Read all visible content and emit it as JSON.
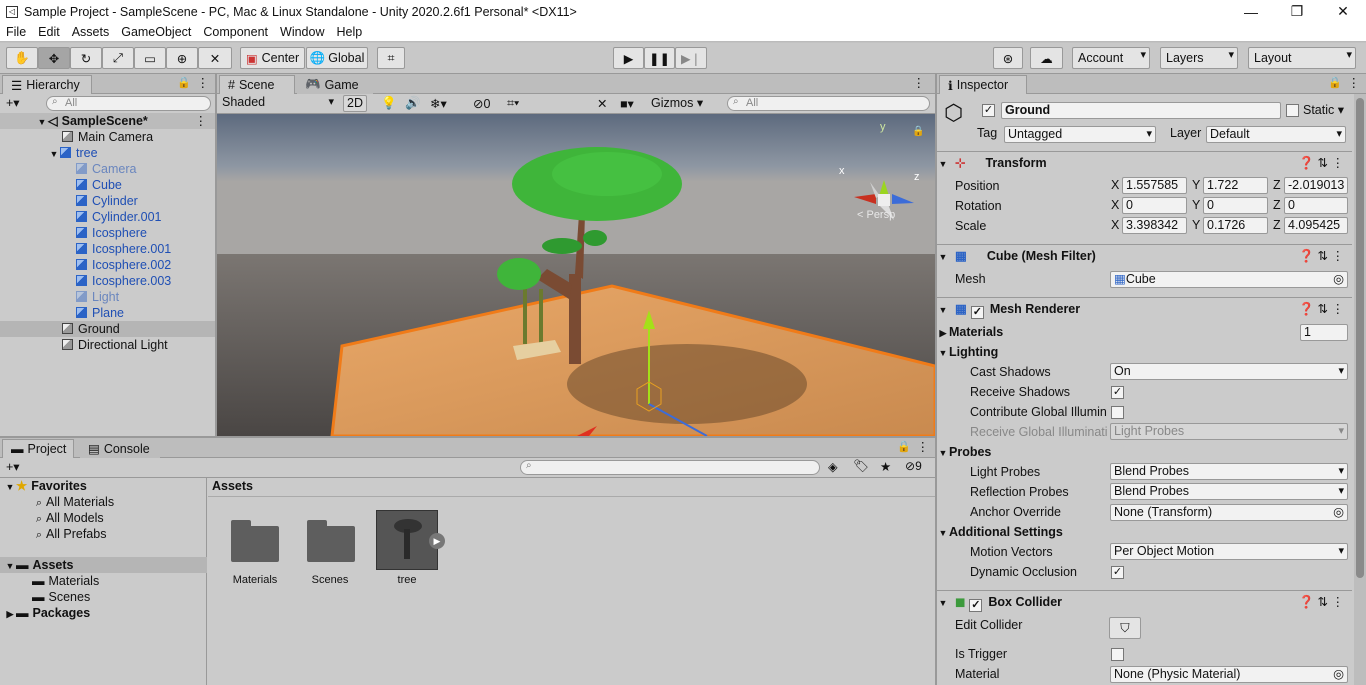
{
  "window": {
    "title": "Sample Project - SampleScene - PC, Mac & Linux Standalone - Unity 2020.2.6f1 Personal* <DX11>",
    "min": "—",
    "max": "❐",
    "close": "✕"
  },
  "menu": [
    "File",
    "Edit",
    "Assets",
    "GameObject",
    "Component",
    "Window",
    "Help"
  ],
  "toolbar": {
    "pivot": "Center",
    "space": "Global",
    "account": "Account",
    "layers": "Layers",
    "layout": "Layout"
  },
  "hierarchy": {
    "tab": "Hierarchy",
    "search_placeholder": "All",
    "scene": "SampleScene*",
    "items": [
      "Main Camera",
      "tree",
      "Camera",
      "Cube",
      "Cylinder",
      "Cylinder.001",
      "Icosphere",
      "Icosphere.001",
      "Icosphere.002",
      "Icosphere.003",
      "Light",
      "Plane",
      "Ground",
      "Directional Light"
    ]
  },
  "scene": {
    "tabs": [
      "Scene",
      "Game"
    ],
    "shading": "Shaded",
    "mode2d": "2D",
    "hidden_count": "0",
    "gizmos": "Gizmos",
    "search_placeholder": "All",
    "persp": "< Persp",
    "axis_x": "x",
    "axis_y": "y",
    "axis_z": "z"
  },
  "project": {
    "tabs": [
      "Project",
      "Console"
    ],
    "badge_count": "9",
    "favorites": {
      "label": "Favorites",
      "items": [
        "All Materials",
        "All Models",
        "All Prefabs"
      ]
    },
    "assets_tree": {
      "label": "Assets",
      "items": [
        "Materials",
        "Scenes"
      ]
    },
    "packages": "Packages",
    "breadcrumb": "Assets",
    "files": [
      "Materials",
      "Scenes",
      "tree"
    ]
  },
  "inspector": {
    "tab": "Inspector",
    "object_name": "Ground",
    "static_label": "Static",
    "tag_label": "Tag",
    "tag_value": "Untagged",
    "layer_label": "Layer",
    "layer_value": "Default",
    "transform": {
      "title": "Transform",
      "position": {
        "label": "Position",
        "x": "1.557585",
        "y": "1.722",
        "z": "-2.019013"
      },
      "rotation": {
        "label": "Rotation",
        "x": "0",
        "y": "0",
        "z": "0"
      },
      "scale": {
        "label": "Scale",
        "x": "3.398342",
        "y": "0.1726",
        "z": "4.095425"
      }
    },
    "mesh_filter": {
      "title": "Cube (Mesh Filter)",
      "mesh_label": "Mesh",
      "mesh_value": "Cube"
    },
    "mesh_renderer": {
      "title": "Mesh Renderer",
      "materials_label": "Materials",
      "materials_count": "1",
      "lighting_label": "Lighting",
      "cast_shadows_label": "Cast Shadows",
      "cast_shadows_value": "On",
      "receive_shadows_label": "Receive Shadows",
      "contribute_gi_label": "Contribute Global Illumin",
      "receive_gi_label": "Receive Global Illuminati",
      "receive_gi_value": "Light Probes",
      "probes_label": "Probes",
      "light_probes_label": "Light Probes",
      "light_probes_value": "Blend Probes",
      "reflection_probes_label": "Reflection Probes",
      "reflection_probes_value": "Blend Probes",
      "anchor_label": "Anchor Override",
      "anchor_value": "None (Transform)",
      "additional_label": "Additional Settings",
      "motion_label": "Motion Vectors",
      "motion_value": "Per Object Motion",
      "occlusion_label": "Dynamic Occlusion"
    },
    "box_collider": {
      "title": "Box Collider",
      "edit_label": "Edit Collider",
      "trigger_label": "Is Trigger",
      "material_label": "Material",
      "material_value": "None (Physic Material)"
    }
  },
  "colors": {
    "accent_blue": "#2b63c6",
    "ground": "#d4935a",
    "tree_leaf": "#3fb53a",
    "selection": "#3d83d8"
  }
}
